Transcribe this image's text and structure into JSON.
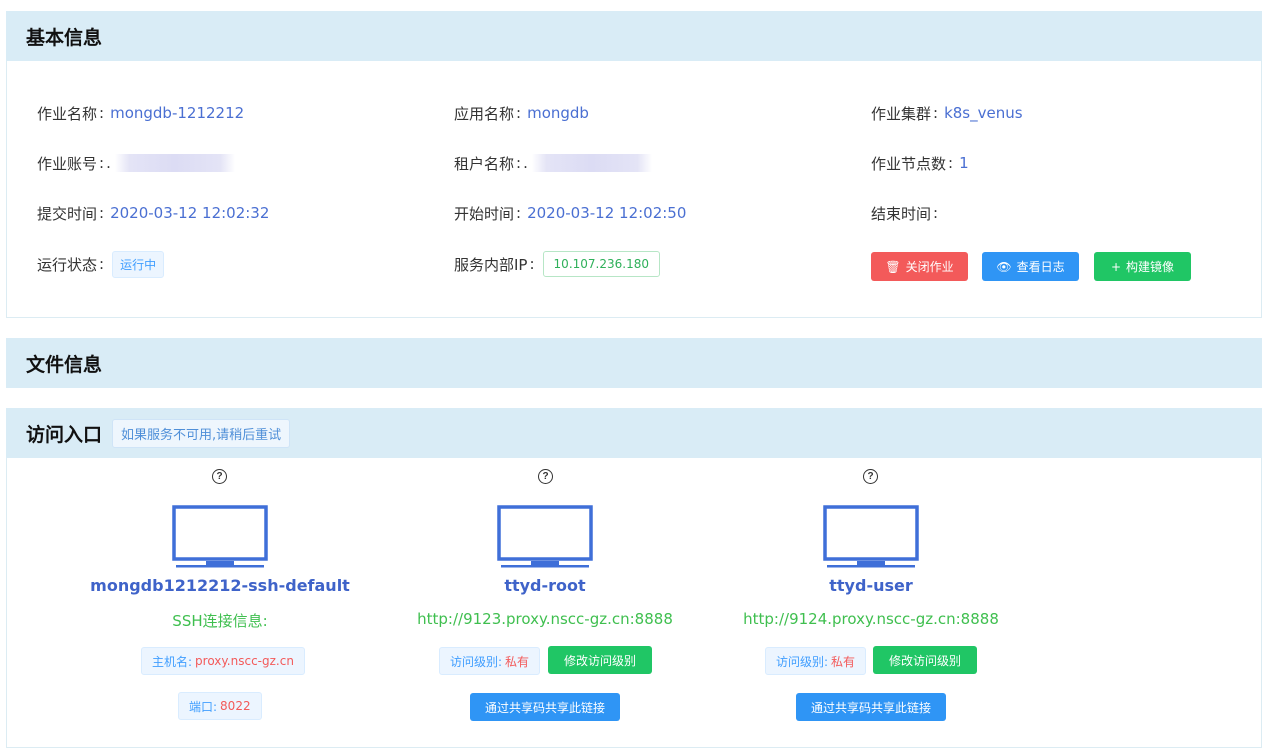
{
  "basic": {
    "title": "基本信息",
    "job_name_label": "作业名称",
    "job_name": "mongdb-1212212",
    "app_name_label": "应用名称",
    "app_name": "mongdb",
    "cluster_label": "作业集群",
    "cluster": "k8s_venus",
    "account_label": "作业账号",
    "account": ".",
    "tenant_label": "租户名称",
    "tenant": ".",
    "nodes_label": "作业节点数",
    "nodes": "1",
    "submit_label": "提交时间",
    "submit_time": "2020-03-12 12:02:32",
    "start_label": "开始时间",
    "start_time": "2020-03-12 12:02:50",
    "end_label": "结束时间",
    "end_time": "",
    "status_label": "运行状态",
    "status": "运行中",
    "ip_label": "服务内部IP",
    "ip": "10.107.236.180",
    "colon": ":",
    "buttons": {
      "close": "关闭作业",
      "log": "查看日志",
      "build": "构建镜像"
    }
  },
  "files": {
    "title": "文件信息"
  },
  "access": {
    "title": "访问入口",
    "tip": "如果服务不可用,请稍后重试",
    "help_glyph": "?",
    "entries": [
      {
        "name": "mongdb1212212-ssh-default",
        "subtitle": "SSH连接信息:",
        "host_label": "主机名:",
        "host": "proxy.nscc-gz.cn",
        "port_label": "端口:",
        "port": "8022"
      },
      {
        "name": "ttyd-root",
        "url": "http://9123.proxy.nscc-gz.cn:8888",
        "level_label": "访问级别:",
        "level": "私有",
        "modify": "修改访问级别",
        "share": "通过共享码共享此链接"
      },
      {
        "name": "ttyd-user",
        "url": "http://9124.proxy.nscc-gz.cn:8888",
        "level_label": "访问级别:",
        "level": "私有",
        "modify": "修改访问级别",
        "share": "通过共享码共享此链接"
      }
    ]
  },
  "colors": {
    "header_bg": "#d9ecf6",
    "link_blue": "#4a6fd2",
    "url_green": "#3fbf4f",
    "danger": "#f35a5a",
    "primary": "#2f95f5",
    "success": "#20c665"
  },
  "icons": {
    "close": "trash-icon",
    "log": "eye-icon",
    "build": "plus-icon",
    "help": "question-circle-icon",
    "entry": "monitor-icon"
  }
}
